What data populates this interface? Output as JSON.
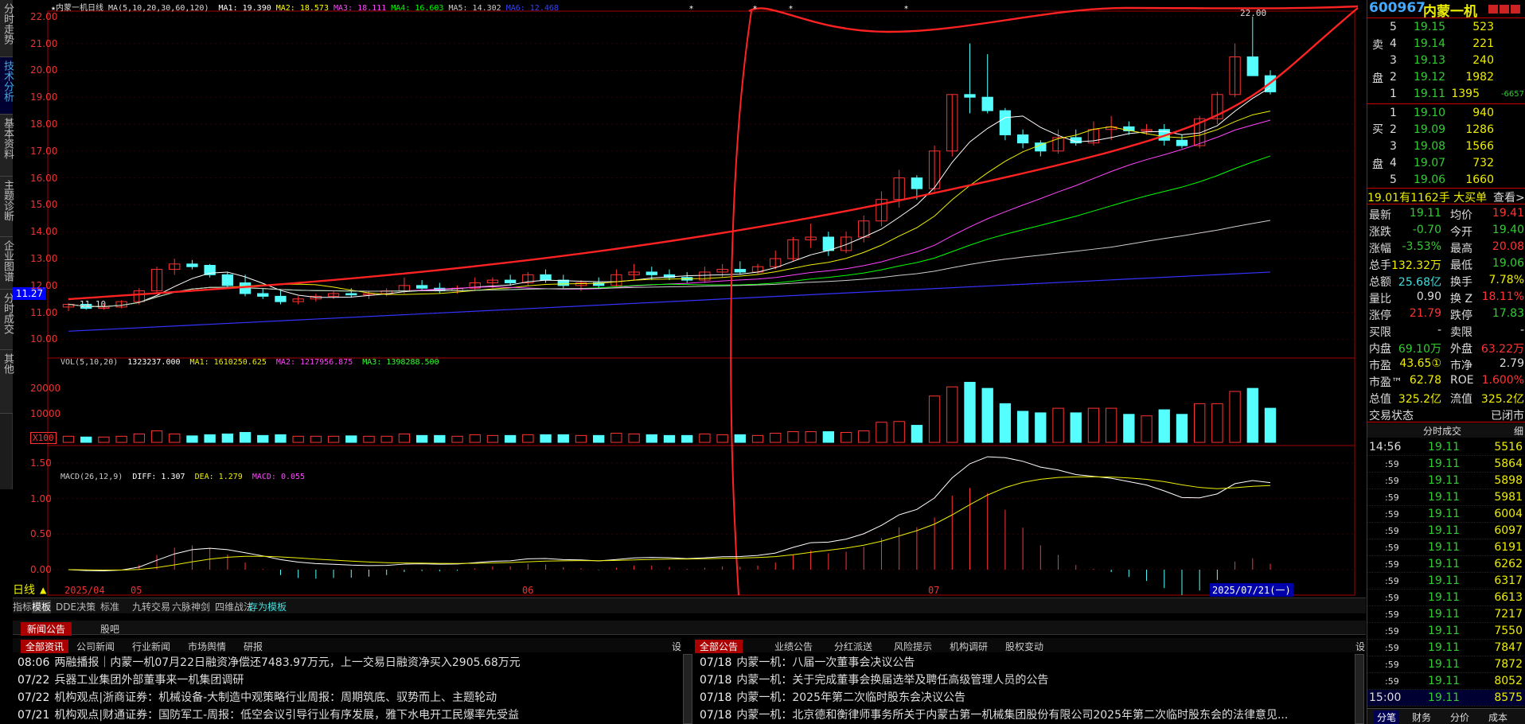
{
  "left_nav": [
    "分时走势",
    "技术分析",
    "基本资料",
    "主题诊断",
    "企业图谱",
    "分时成交",
    "其他"
  ],
  "left_nav_active": 1,
  "chart": {
    "title_line": "★内蒙一机日线 MA(5,10,20,30,60,120)",
    "ma": [
      {
        "name": "MA1:",
        "value": "19.390",
        "color": "#ffffff"
      },
      {
        "name": "MA2:",
        "value": "18.573",
        "color": "#ffff00"
      },
      {
        "name": "MA3:",
        "value": "18.111",
        "color": "#ff44ff"
      },
      {
        "name": "MA4:",
        "value": "16.603",
        "color": "#00ff00"
      },
      {
        "name": "MA5:",
        "value": "14.302",
        "color": "#cccccc"
      },
      {
        "name": "MA6:",
        "value": "12.468",
        "color": "#3344ff"
      }
    ],
    "price_labels": [
      "22.00",
      "21.00",
      "20.00",
      "19.00",
      "18.00",
      "17.00",
      "16.00",
      "15.00",
      "14.00",
      "13.00",
      "12.00",
      "11.00",
      "10.00"
    ],
    "current_price_box": "11.27",
    "high_marker": "22.00",
    "low_marker": "11.10",
    "vol_legend": {
      "title": "VOL(5,10,20)",
      "value": "1323237.000",
      "ma1": "MA1: 1610250.625",
      "ma2": "MA2: 1217956.875",
      "ma3": "MA3: 1398288.500"
    },
    "vol_labels": [
      "20000",
      "10000"
    ],
    "vol_unit": "X100",
    "macd_legend": {
      "title": "MACD(26,12,9)",
      "diff": "DIFF: 1.307",
      "dea": "DEA: 1.279",
      "macd": "MACD: 0.055"
    },
    "macd_labels": [
      "1.50",
      "1.00",
      "0.50",
      "0.00"
    ],
    "period_label": "日线",
    "date_labels": [
      "2025/04",
      "05",
      "06",
      "07"
    ],
    "cursor_date": "2025/07/21(一)"
  },
  "chart_data": {
    "type": "candlestick",
    "dates_first": "2025/04",
    "ohlc": [
      [
        11.2,
        11.35,
        11.05,
        11.3
      ],
      [
        11.3,
        11.3,
        11.1,
        11.15
      ],
      [
        11.15,
        11.3,
        11.1,
        11.2
      ],
      [
        11.2,
        11.45,
        11.15,
        11.4
      ],
      [
        11.4,
        11.9,
        11.3,
        11.8
      ],
      [
        11.8,
        12.7,
        11.7,
        12.6
      ],
      [
        12.6,
        13.0,
        12.4,
        12.8
      ],
      [
        12.8,
        12.95,
        12.6,
        12.7
      ],
      [
        12.75,
        12.8,
        12.3,
        12.4
      ],
      [
        12.4,
        12.5,
        11.9,
        12.0
      ],
      [
        12.1,
        12.4,
        11.6,
        11.7
      ],
      [
        11.7,
        11.9,
        11.5,
        11.6
      ],
      [
        11.6,
        11.8,
        11.3,
        11.4
      ],
      [
        11.4,
        11.6,
        11.3,
        11.5
      ],
      [
        11.5,
        11.7,
        11.4,
        11.6
      ],
      [
        11.6,
        11.8,
        11.5,
        11.7
      ],
      [
        11.7,
        11.9,
        11.55,
        11.65
      ],
      [
        11.65,
        11.8,
        11.5,
        11.7
      ],
      [
        11.7,
        11.9,
        11.6,
        11.8
      ],
      [
        11.8,
        12.3,
        11.7,
        12.0
      ],
      [
        12.0,
        12.2,
        11.8,
        11.9
      ],
      [
        11.9,
        12.1,
        11.7,
        11.8
      ],
      [
        11.8,
        12.0,
        11.7,
        11.9
      ],
      [
        11.9,
        12.3,
        11.8,
        12.1
      ],
      [
        12.1,
        12.3,
        11.9,
        12.2
      ],
      [
        12.2,
        12.4,
        12.0,
        12.1
      ],
      [
        12.1,
        12.5,
        12.0,
        12.4
      ],
      [
        12.4,
        12.6,
        12.1,
        12.2
      ],
      [
        12.2,
        12.4,
        11.9,
        12.0
      ],
      [
        12.0,
        12.2,
        11.8,
        12.1
      ],
      [
        12.1,
        12.3,
        11.9,
        12.0
      ],
      [
        12.0,
        12.6,
        11.9,
        12.4
      ],
      [
        12.4,
        12.8,
        12.2,
        12.5
      ],
      [
        12.5,
        12.7,
        12.2,
        12.4
      ],
      [
        12.4,
        12.6,
        12.2,
        12.3
      ],
      [
        12.3,
        12.5,
        12.1,
        12.2
      ],
      [
        12.2,
        12.7,
        12.1,
        12.5
      ],
      [
        12.5,
        12.8,
        12.3,
        12.6
      ],
      [
        12.6,
        12.9,
        12.4,
        12.5
      ],
      [
        12.5,
        12.8,
        12.4,
        12.7
      ],
      [
        12.7,
        13.3,
        12.6,
        13.0
      ],
      [
        13.0,
        13.8,
        12.9,
        13.7
      ],
      [
        13.7,
        14.3,
        13.4,
        13.8
      ],
      [
        13.8,
        14.0,
        13.1,
        13.3
      ],
      [
        13.3,
        14.0,
        13.2,
        13.8
      ],
      [
        13.8,
        14.6,
        13.6,
        14.4
      ],
      [
        14.4,
        15.5,
        14.2,
        15.2
      ],
      [
        15.2,
        16.3,
        14.9,
        16.0
      ],
      [
        16.0,
        16.1,
        15.2,
        15.6
      ],
      [
        15.6,
        17.2,
        15.5,
        17.0
      ],
      [
        17.0,
        19.1,
        16.8,
        19.1
      ],
      [
        19.1,
        21.0,
        18.4,
        19.0
      ],
      [
        19.0,
        20.6,
        18.4,
        18.5
      ],
      [
        18.5,
        18.6,
        17.4,
        17.6
      ],
      [
        17.6,
        17.8,
        17.1,
        17.3
      ],
      [
        17.3,
        17.4,
        16.8,
        17.0
      ],
      [
        17.0,
        17.8,
        16.9,
        17.5
      ],
      [
        17.5,
        17.8,
        17.2,
        17.3
      ],
      [
        17.3,
        18.1,
        17.2,
        17.8
      ],
      [
        17.8,
        18.3,
        17.4,
        17.9
      ],
      [
        17.9,
        18.1,
        17.6,
        17.75
      ],
      [
        17.75,
        18.0,
        17.6,
        17.8
      ],
      [
        17.8,
        18.0,
        17.2,
        17.4
      ],
      [
        17.4,
        17.6,
        17.1,
        17.2
      ],
      [
        17.2,
        18.3,
        17.1,
        18.2
      ],
      [
        18.2,
        19.2,
        18.0,
        19.1
      ],
      [
        19.1,
        21.0,
        19.0,
        20.5
      ],
      [
        20.5,
        22.0,
        19.8,
        19.8
      ],
      [
        19.8,
        20.0,
        19.1,
        19.2
      ]
    ]
  },
  "tabbar": [
    "指标",
    "模板",
    "DDE决策",
    "标准",
    "九转交易",
    "六脉神剑",
    "四维战法",
    "存为模板"
  ],
  "news": {
    "top_tabs": [
      "新闻公告",
      "股吧"
    ],
    "left_tabs": [
      "全部资讯",
      "公司新闻",
      "行业新闻",
      "市场舆情",
      "研报"
    ],
    "right_tabs": [
      "全部公告",
      "业绩公告",
      "分红派送",
      "风险提示",
      "机构调研",
      "股权变动"
    ],
    "settings": "设",
    "left_rows": [
      {
        "time": "08:06",
        "text": "两融播报｜内蒙一机07月22日融资净偿还7483.97万元，上一交易日融资净买入2905.68万元"
      },
      {
        "time": "07/22",
        "text": "兵器工业集团外部董事来一机集团调研"
      },
      {
        "time": "07/22",
        "text": "机构观点|浙商证券：机械设备-大制造中观策略行业周报：周期筑底、驭势而上、主题轮动"
      },
      {
        "time": "07/21",
        "text": "机构观点|财通证券：国防军工-周报：低空会议引导行业有序发展，雅下水电开工民爆率先受益"
      }
    ],
    "right_rows": [
      {
        "time": "07/18",
        "text": "内蒙一机：八届一次董事会决议公告"
      },
      {
        "time": "07/18",
        "text": "内蒙一机：关于完成董事会换届选举及聘任高级管理人员的公告"
      },
      {
        "time": "07/18",
        "text": "内蒙一机：2025年第二次临时股东会决议公告"
      },
      {
        "time": "07/18",
        "text": "内蒙一机：北京德和衡律师事务所关于内蒙古第一机械集团股份有限公司2025年第二次临时股东会的法律意见..."
      }
    ]
  },
  "quote": {
    "code": "600967",
    "name": "内蒙一机",
    "sell_label": [
      "卖",
      "盘"
    ],
    "buy_label": [
      "买",
      "盘"
    ],
    "sell": [
      {
        "lvl": "5",
        "price": "19.15",
        "vol": "523"
      },
      {
        "lvl": "4",
        "price": "19.14",
        "vol": "221"
      },
      {
        "lvl": "3",
        "price": "19.13",
        "vol": "240"
      },
      {
        "lvl": "2",
        "price": "19.12",
        "vol": "1982"
      },
      {
        "lvl": "1",
        "price": "19.11",
        "vol": "1395",
        "chg": "-6657"
      }
    ],
    "buy": [
      {
        "lvl": "1",
        "price": "19.10",
        "vol": "940"
      },
      {
        "lvl": "2",
        "price": "19.09",
        "vol": "1286"
      },
      {
        "lvl": "3",
        "price": "19.08",
        "vol": "1566"
      },
      {
        "lvl": "4",
        "price": "19.07",
        "vol": "732"
      },
      {
        "lvl": "5",
        "price": "19.06",
        "vol": "1660"
      }
    ],
    "big_order": {
      "text": "19.01有1162手 大买单",
      "link": "查看>"
    },
    "stats": [
      {
        "l1": "最新",
        "v1": "19.11",
        "c1": "grn",
        "l2": "均价",
        "v2": "19.41",
        "c2": "red"
      },
      {
        "l1": "涨跌",
        "v1": "-0.70",
        "c1": "grn",
        "l2": "今开",
        "v2": "19.40",
        "c2": "grn"
      },
      {
        "l1": "涨幅",
        "v1": "-3.53%",
        "c1": "grn",
        "l2": "最高",
        "v2": "20.08",
        "c2": "red"
      },
      {
        "l1": "总手",
        "v1": "132.32万",
        "c1": "yel",
        "l2": "最低",
        "v2": "19.06",
        "c2": "grn"
      },
      {
        "l1": "总额",
        "v1": "25.68亿",
        "c1": "cyn",
        "l2": "换手",
        "v2": "7.78%",
        "c2": "yel"
      },
      {
        "l1": "量比",
        "v1": "0.90",
        "c1": "wht",
        "l2": "换 Z",
        "v2": "18.11%",
        "c2": "red"
      },
      {
        "l1": "涨停",
        "v1": "21.79",
        "c1": "red",
        "l2": "跌停",
        "v2": "17.83",
        "c2": "grn"
      },
      {
        "l1": "买限",
        "v1": "-",
        "c1": "wht",
        "l2": "卖限",
        "v2": "-",
        "c2": "wht"
      },
      {
        "l1": "内盘",
        "v1": "69.10万",
        "c1": "grn",
        "l2": "外盘",
        "v2": "63.22万",
        "c2": "red"
      },
      {
        "l1": "市盈",
        "v1": "43.65①",
        "c1": "yel",
        "l2": "市净",
        "v2": "2.79",
        "c2": "wht"
      },
      {
        "l1": "市盈™",
        "v1": "62.78",
        "c1": "yel",
        "l2": "ROE",
        "v2": "1.600%",
        "c2": "red"
      },
      {
        "l1": "总值",
        "v1": "325.2亿",
        "c1": "yel",
        "l2": "流值",
        "v2": "325.2亿",
        "c2": "yel"
      },
      {
        "l1": "交易状态",
        "v1": "",
        "c1": "wht",
        "l2": "",
        "v2": "已闭市",
        "c2": "wht"
      }
    ],
    "ticks_header": [
      "分时成交",
      "细"
    ],
    "ticks": [
      {
        "t": "14:56",
        "p": "19.11",
        "v": "5516"
      },
      {
        "t": ":59",
        "p": "19.11",
        "v": "5864"
      },
      {
        "t": ":59",
        "p": "19.11",
        "v": "5898"
      },
      {
        "t": ":59",
        "p": "19.11",
        "v": "5981"
      },
      {
        "t": ":59",
        "p": "19.11",
        "v": "6004"
      },
      {
        "t": ":59",
        "p": "19.11",
        "v": "6097"
      },
      {
        "t": ":59",
        "p": "19.11",
        "v": "6191"
      },
      {
        "t": ":59",
        "p": "19.11",
        "v": "6262"
      },
      {
        "t": ":59",
        "p": "19.11",
        "v": "6317"
      },
      {
        "t": ":59",
        "p": "19.11",
        "v": "6613"
      },
      {
        "t": ":59",
        "p": "19.11",
        "v": "7217"
      },
      {
        "t": ":59",
        "p": "19.11",
        "v": "7550"
      },
      {
        "t": ":59",
        "p": "19.11",
        "v": "7847"
      },
      {
        "t": ":59",
        "p": "19.11",
        "v": "7872"
      },
      {
        "t": ":59",
        "p": "19.11",
        "v": "8052"
      },
      {
        "t": "15:00",
        "p": "19.11",
        "v": "8575"
      }
    ],
    "bottom_tabs": [
      "分笔",
      "财务",
      "分价",
      "成本"
    ]
  }
}
